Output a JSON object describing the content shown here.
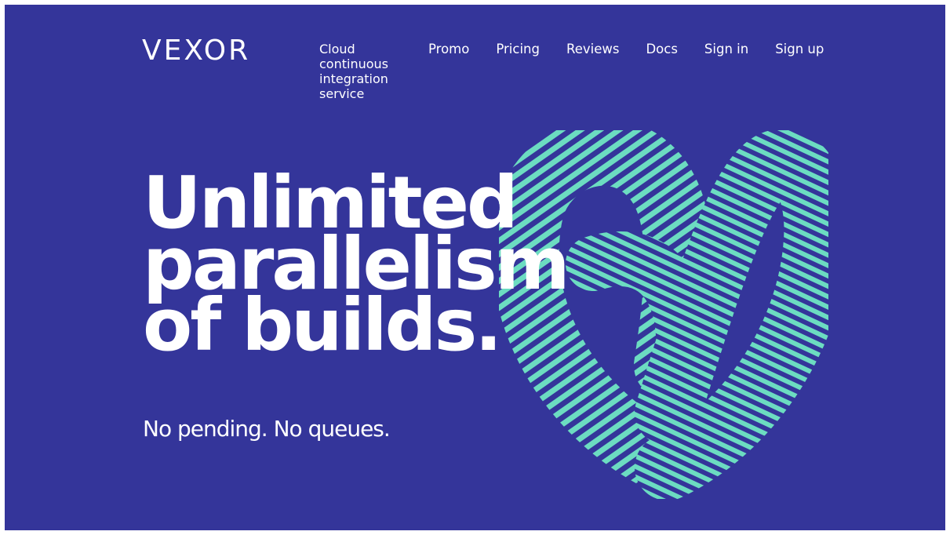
{
  "brand": {
    "logo_text": "VEXOR",
    "tagline": "Cloud continuous integration service"
  },
  "nav": {
    "items": [
      {
        "label": "Promo"
      },
      {
        "label": "Pricing"
      },
      {
        "label": "Reviews"
      },
      {
        "label": "Docs"
      },
      {
        "label": "Sign in"
      },
      {
        "label": "Sign up"
      }
    ]
  },
  "hero": {
    "headline_lines": [
      "Unlimited",
      "parallelism",
      "of builds."
    ],
    "subheadline": "No pending. No queues."
  },
  "colors": {
    "background": "#34359a",
    "accent": "#6cdcc1",
    "text": "#ffffff"
  },
  "icons": {
    "hero_graphic": "striped-tube-v-illustration"
  }
}
